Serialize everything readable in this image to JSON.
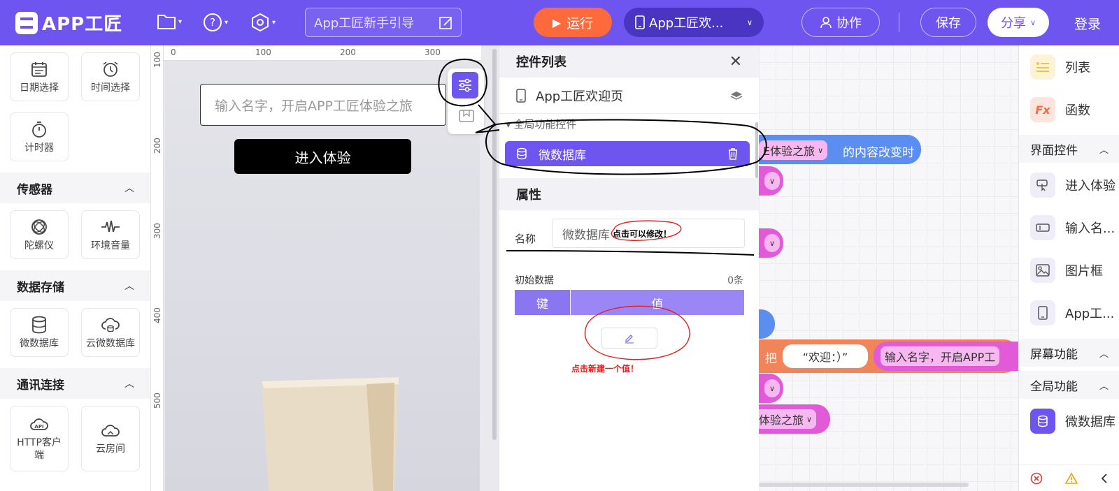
{
  "header": {
    "logo_text": "APP工匠",
    "project_name": "App工匠新手引导",
    "run_label": "运行",
    "page_selector": "App工匠欢...",
    "collab_label": "协作",
    "save_label": "保存",
    "share_label": "分享",
    "login_label": "登录"
  },
  "left_palette": {
    "items_top": [
      "日期选择",
      "时间选择",
      "计时器"
    ],
    "sections": [
      {
        "title": "传感器",
        "items": [
          "陀螺仪",
          "环境音量"
        ]
      },
      {
        "title": "数据存储",
        "items": [
          "微数据库",
          "云微数据库"
        ]
      },
      {
        "title": "通讯连接",
        "items": [
          "HTTP客户端",
          "云房间"
        ]
      }
    ]
  },
  "canvas": {
    "ruler_x": [
      "0",
      "100",
      "200",
      "300"
    ],
    "ruler_y": [
      "100",
      "200",
      "300",
      "400",
      "500"
    ],
    "input_placeholder": "输入名字，开启APP工匠体验之旅",
    "enter_button": "进入体验"
  },
  "controls_panel": {
    "title": "控件列表",
    "page_item": "App工匠欢迎页",
    "group_label": "全局功能控件",
    "selected_item": "微数据库",
    "attr_title": "属性",
    "name_label": "名称",
    "name_value": "微数据库",
    "annotation_edit": "点击可以修改！",
    "initial_data_label": "初始数据",
    "count": "0条",
    "key_header": "键",
    "value_header": "值",
    "annotation_add": "点击新建一个值！"
  },
  "workspace": {
    "b1_text_a": "E体验之旅",
    "b1_text_b": "的内容改变时",
    "b2_prefix": "把",
    "b2_string": "“欢迎：）”",
    "b2_text": "输入名字，开启APP工",
    "b3_text": "体验之旅"
  },
  "right_palette": {
    "items_top": [
      {
        "label": "列表",
        "color": "#f6c445"
      },
      {
        "label": "函数",
        "color": "#f26b4a"
      }
    ],
    "sect_ui": "界面控件",
    "ui_items": [
      "进入体验",
      "输入名...",
      "图片框",
      "App工..."
    ],
    "sect_screen": "屏幕功能",
    "sect_global": "全局功能",
    "global_item": "微数据库"
  },
  "colors": {
    "brand": "#6f55f0",
    "run": "#ff6a3d",
    "block_blue": "#5b8ef0",
    "block_pink": "#e25ad8",
    "block_orange": "#f2845a",
    "annotation_red": "#e02020"
  }
}
